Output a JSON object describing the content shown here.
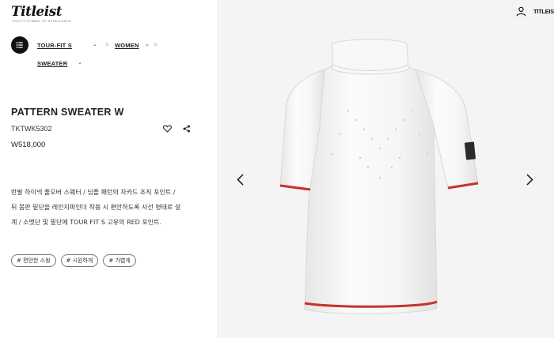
{
  "logo": {
    "word": "Titleist",
    "tagline": "GOLF'S SYMBOL OF EXCELLENCE"
  },
  "header": {
    "brand_short": "TITLEIST"
  },
  "breadcrumb": {
    "items": [
      {
        "label": "TOUR-FIT S"
      },
      {
        "label": "WOMEN"
      },
      {
        "label": "SWEATER"
      }
    ],
    "separator": ">"
  },
  "product": {
    "title": "PATTERN SWEATER W",
    "code": "TKTWK5302",
    "price": "W518,000",
    "description_lines": [
      "반팔 하이넥 풀오버 스웨터 / 딤플 패턴의 자카드 조직 포인트 /",
      "뒤 몸판 밑단을 레인지파인더 착용 시 편안하도록 사선 형태로 설",
      "계 / 소맷단 및 밑단에 TOUR FIT S 고유의 RED 포인트."
    ],
    "tags": [
      "# 편안한 스윙",
      "# 시원하게",
      "# 가볍게"
    ]
  },
  "icons": {
    "menu": "list-menu-icon",
    "wishlist": "heart-icon",
    "share": "share-icon",
    "user": "user-icon",
    "prev": "chevron-left-icon",
    "next": "chevron-right-icon"
  },
  "colors": {
    "accent_red": "#c8322c",
    "image_bg": "#f4f4f4"
  }
}
